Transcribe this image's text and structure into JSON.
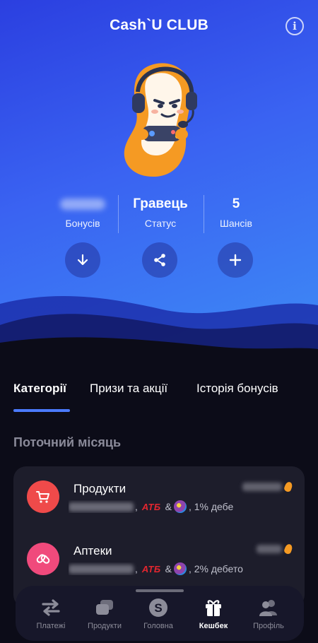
{
  "header": {
    "title": "Cash`U CLUB",
    "info_label": "i"
  },
  "stats": {
    "bonuses": {
      "value": "",
      "label": "Бонусів"
    },
    "status": {
      "value": "Гравець",
      "label": "Статус"
    },
    "chances": {
      "value": "5",
      "label": "Шансів"
    }
  },
  "actions": [
    {
      "name": "download",
      "icon": "arrow-down-icon"
    },
    {
      "name": "share",
      "icon": "share-icon"
    },
    {
      "name": "add",
      "icon": "plus-icon"
    }
  ],
  "tabs": [
    {
      "label": "Категорії",
      "active": true
    },
    {
      "label": "Призи та акції",
      "active": false
    },
    {
      "label": "Історія бонусів",
      "active": false
    }
  ],
  "section": {
    "title": "Поточний місяць"
  },
  "categories": [
    {
      "name": "Продукти",
      "store": "АТБ",
      "amp": "&",
      "suffix": ", 1% дебе",
      "icon": "cart-icon",
      "color": "#ef4a4a"
    },
    {
      "name": "Аптеки",
      "store": "АТБ",
      "amp": "&",
      "suffix": ", 2% дебето",
      "icon": "pharmacy-icon",
      "color": "#f04a7c"
    }
  ],
  "nav": [
    {
      "label": "Платежі",
      "icon": "transfer-icon",
      "active": false
    },
    {
      "label": "Продукти",
      "icon": "cards-icon",
      "active": false
    },
    {
      "label": "Головна",
      "icon": "home-logo-icon",
      "active": false
    },
    {
      "label": "Кешбек",
      "icon": "gift-icon",
      "active": true
    },
    {
      "label": "Профіль",
      "icon": "profile-icon",
      "active": false
    }
  ],
  "colors": {
    "accent": "#4b7bff",
    "hero_start": "#2b3fe0",
    "hero_end": "#3e8df5",
    "background": "#0c0c18"
  }
}
